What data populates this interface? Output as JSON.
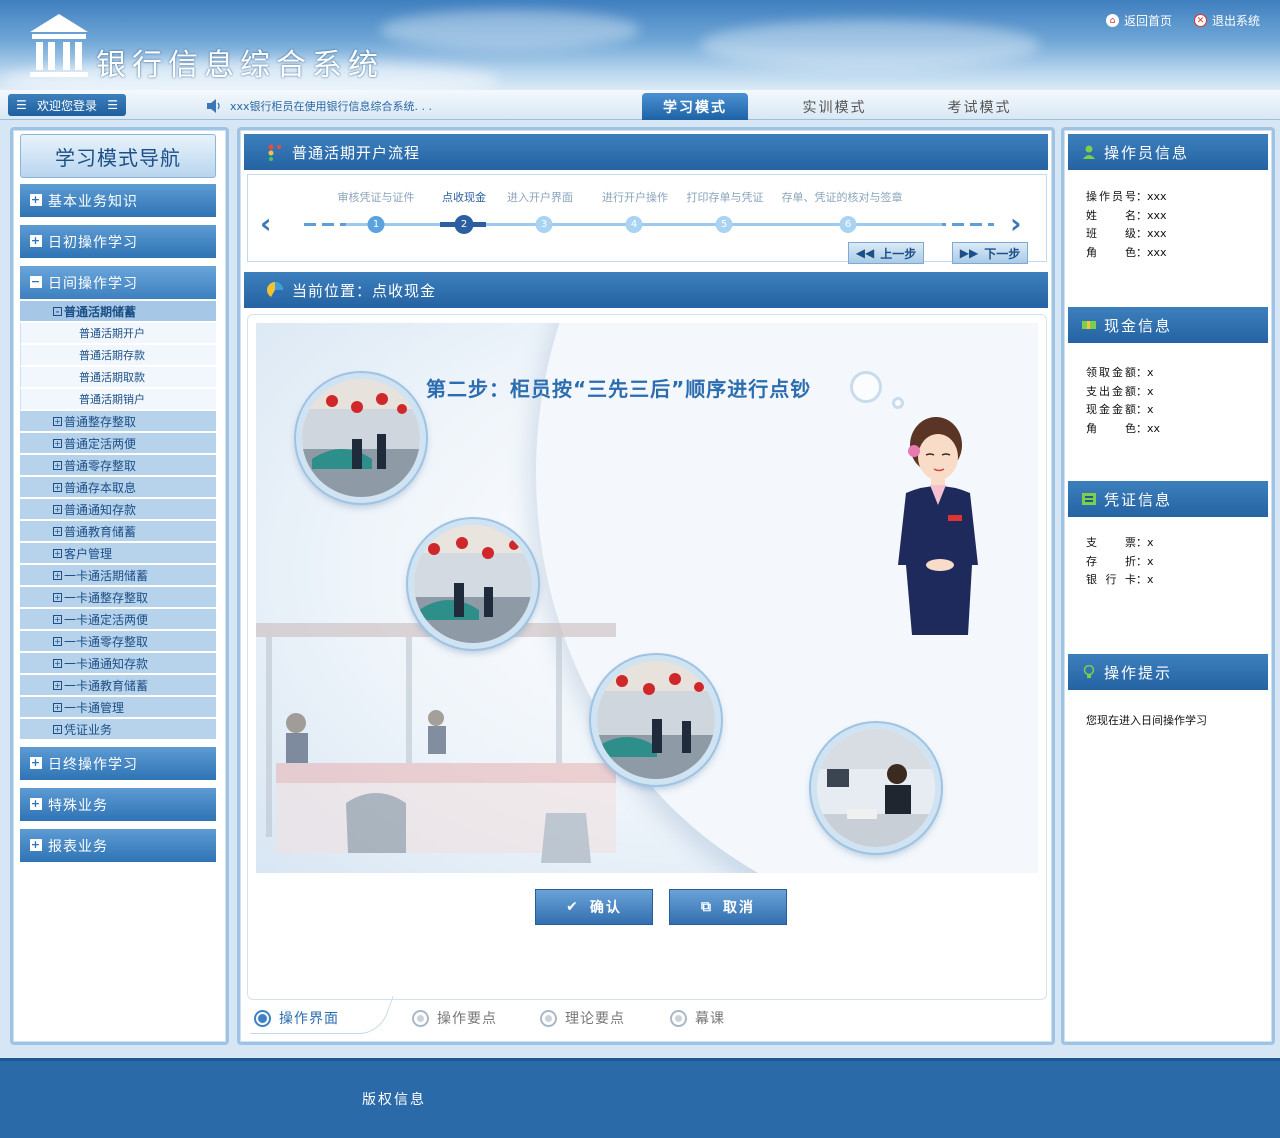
{
  "header": {
    "system_title": "银行信息综合系统",
    "home_link": "返回首页",
    "logout_link": "退出系统"
  },
  "navbar": {
    "welcome": "欢迎您登录",
    "marquee": "xxx银行柜员在使用银行信息综合系统. . .",
    "mode_tabs": [
      "学习模式",
      "实训模式",
      "考试模式"
    ],
    "active_mode": "学习模式"
  },
  "left_nav": {
    "title": "学习模式导航",
    "categories_top": [
      "基本业务知识",
      "日初操作学习"
    ],
    "open_category": "日间操作学习",
    "open_sub": "普通活期储蓄",
    "leaves": [
      "普通活期开户",
      "普通活期存款",
      "普通活期取款",
      "普通活期销户"
    ],
    "subs": [
      "普通整存整取",
      "普通定活两便",
      "普通零存整取",
      "普通存本取息",
      "普通通知存款",
      "普通教育储蓄",
      "客户管理",
      "一卡通活期储蓄",
      "一卡通整存整取",
      "一卡通定活两便",
      "一卡通零存整取",
      "一卡通通知存款",
      "一卡通教育储蓄",
      "一卡通管理",
      "凭证业务"
    ],
    "categories_bottom": [
      "日终操作学习",
      "特殊业务",
      "报表业务"
    ]
  },
  "flow": {
    "title": "普通活期开户流程",
    "steps": [
      "审核凭证与证件",
      "点收现金",
      "进入开户界面",
      "进行开户操作",
      "打印存单与凭证",
      "存单、凭证的核对与签章"
    ],
    "step_numbers": [
      "1",
      "2",
      "3",
      "4",
      "5",
      "6"
    ],
    "active_step": 2,
    "prev_btn": "上一步",
    "next_btn": "下一步"
  },
  "location": {
    "label": "当前位置：点收现金"
  },
  "scene": {
    "title": "第二步：柜员按“三先三后”顺序进行点钞",
    "confirm": "确认",
    "cancel": "取消"
  },
  "bottom_tabs": [
    "操作界面",
    "操作要点",
    "理论要点",
    "幕课"
  ],
  "right": {
    "operator_head": "操作员信息",
    "operator": [
      {
        "k": "操作员号",
        "v": "xxx"
      },
      {
        "k": "姓名",
        "v": "xxx"
      },
      {
        "k": "班级",
        "v": "xxx"
      },
      {
        "k": "角色",
        "v": "xxx"
      }
    ],
    "cash_head": "现金信息",
    "cash": [
      {
        "k": "领取金额",
        "v": "x"
      },
      {
        "k": "支出金额",
        "v": "x"
      },
      {
        "k": "现金金额",
        "v": "x"
      },
      {
        "k": "角色",
        "v": "xx"
      }
    ],
    "voucher_head": "凭证信息",
    "voucher": [
      {
        "k": "支票",
        "v": "x"
      },
      {
        "k": "存折",
        "v": "x"
      },
      {
        "k": "银行卡",
        "v": "x"
      }
    ],
    "tip_head": "操作提示",
    "tip": "您现在进入日间操作学习"
  },
  "footer": {
    "copyright": "版权信息"
  },
  "colors": {
    "primary": "#2f74b5",
    "header_bar": "#2563a3",
    "footer": "#2a6aa8",
    "accent_text": "#2c6db0"
  }
}
